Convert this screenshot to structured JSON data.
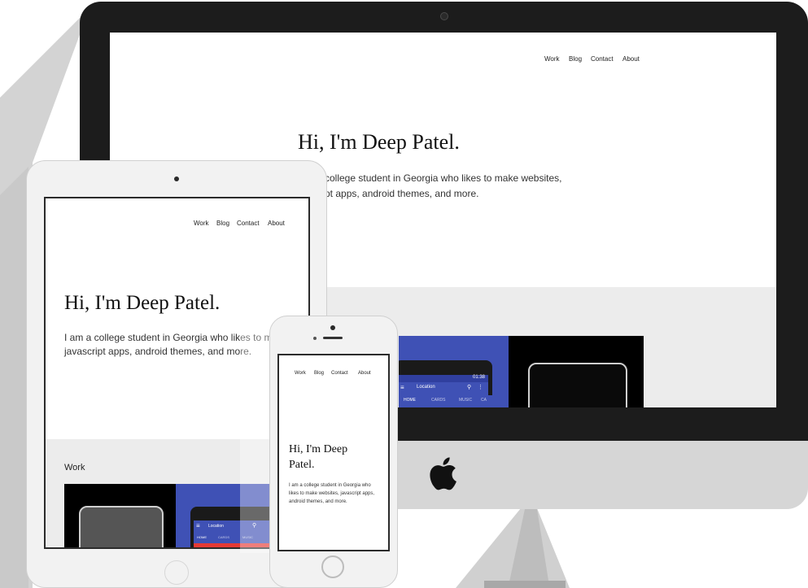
{
  "site": {
    "nav": [
      "Work",
      "Blog",
      "Contact",
      "About"
    ],
    "heading": "Hi, I'm Deep Patel.",
    "bio_line1": "I am a college student in Georgia who likes to make websites,",
    "bio_line2": "javascript apps, android themes, and more.",
    "work_heading": "Work"
  },
  "desktop_view": {
    "bio_line1": "college student in Georgia who likes to make websites,",
    "bio_line2": "pt apps, android themes, and more."
  },
  "tablet_view": {
    "bio_line1": "I am a college student in Georgia who likes to make websi"
  },
  "phone_view": {
    "heading_line1": "Hi, I'm Deep",
    "heading_line2": "Patel.",
    "bio_lines": [
      "I am a college student in Georgia who",
      "likes to make websites, javascript apps,",
      "android themes, and more."
    ]
  },
  "app_preview": {
    "toolbar_title": "Location",
    "status_time": "01:38",
    "tabs": [
      "HOME",
      "CARDS",
      "MUSIC",
      "CA"
    ]
  },
  "colors": {
    "imac_bezel": "#1c1c1c",
    "imac_chin": "#d6d6d6",
    "app_accent": "#3f51b5",
    "section_grey": "#ececec"
  }
}
